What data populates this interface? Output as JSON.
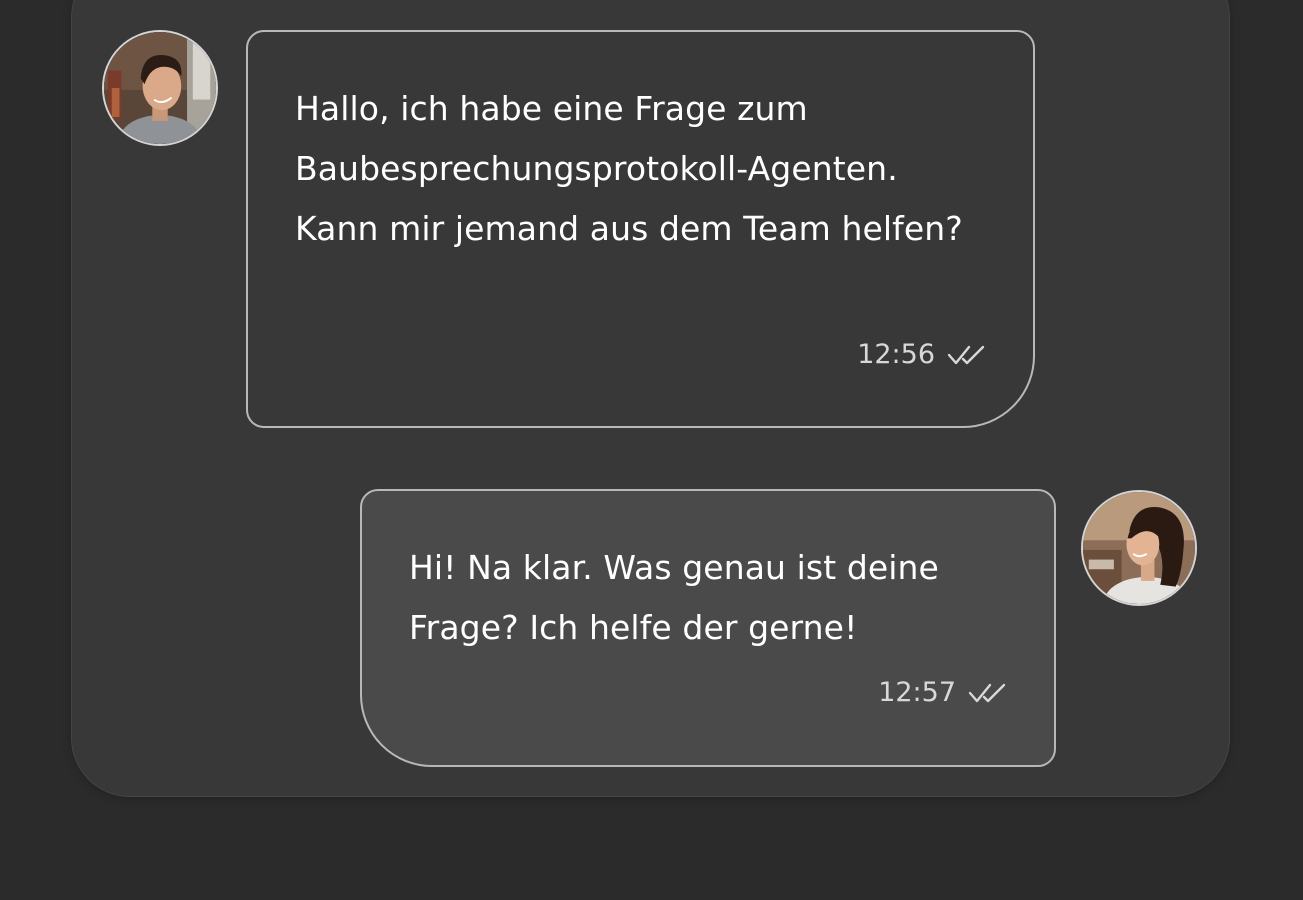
{
  "messages": [
    {
      "direction": "incoming",
      "text": "Hallo, ich habe eine Frage zum Baubesprechungsprotokoll-Agenten. Kann mir jemand aus dem Team helfen?",
      "time": "12:56",
      "status_icon": "double-check-icon",
      "avatar": "male-user-avatar"
    },
    {
      "direction": "outgoing",
      "text": "Hi! Na klar. Was genau ist deine Frage? Ich helfe der gerne!",
      "time": "12:57",
      "status_icon": "double-check-icon",
      "avatar": "female-user-avatar"
    }
  ],
  "colors": {
    "page_background": "#2b2b2b",
    "panel_background": "#383838",
    "incoming_bubble": "#383838",
    "outgoing_bubble": "#4a4a4a",
    "bubble_border": "#b8b8b4",
    "text": "#ffffff",
    "meta_text": "#d8d8d8"
  }
}
